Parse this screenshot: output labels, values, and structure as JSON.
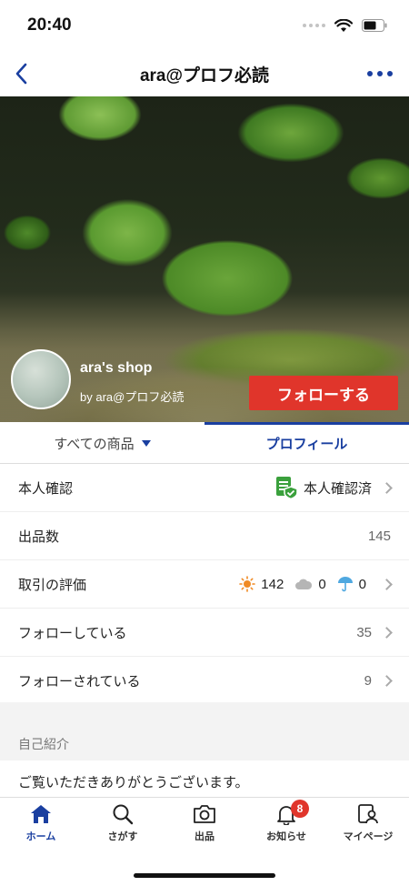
{
  "status_bar": {
    "time": "20:40"
  },
  "nav": {
    "title": "ara@プロフ必読"
  },
  "shop": {
    "name": "ara's shop",
    "by": "by ara@プロフ必読",
    "follow_label": "フォローする"
  },
  "tabs": {
    "all_items": "すべての商品",
    "profile": "プロフィール"
  },
  "rows": {
    "identity": {
      "label": "本人確認",
      "value": "本人確認済"
    },
    "listings": {
      "label": "出品数",
      "value": "145"
    },
    "rating": {
      "label": "取引の評価",
      "good": "142",
      "normal": "0",
      "bad": "0"
    },
    "following": {
      "label": "フォローしている",
      "value": "35"
    },
    "followers": {
      "label": "フォローされている",
      "value": "9"
    }
  },
  "intro": {
    "title": "自己紹介",
    "text": "ご覧いただきありがとうございます。"
  },
  "tab_bar": {
    "items": [
      {
        "label": "ホーム",
        "icon": "home-icon"
      },
      {
        "label": "さがす",
        "icon": "search-icon"
      },
      {
        "label": "出品",
        "icon": "camera-icon"
      },
      {
        "label": "お知らせ",
        "icon": "bell-icon"
      },
      {
        "label": "マイページ",
        "icon": "user-icon"
      }
    ],
    "notification_badge": "8"
  },
  "colors": {
    "accent": "#1a3fa0",
    "follow": "#e0352b",
    "verified": "#3aa03c",
    "sun": "#f08a24",
    "cloud": "#b5b5b5",
    "umbrella": "#4fa8e0"
  }
}
